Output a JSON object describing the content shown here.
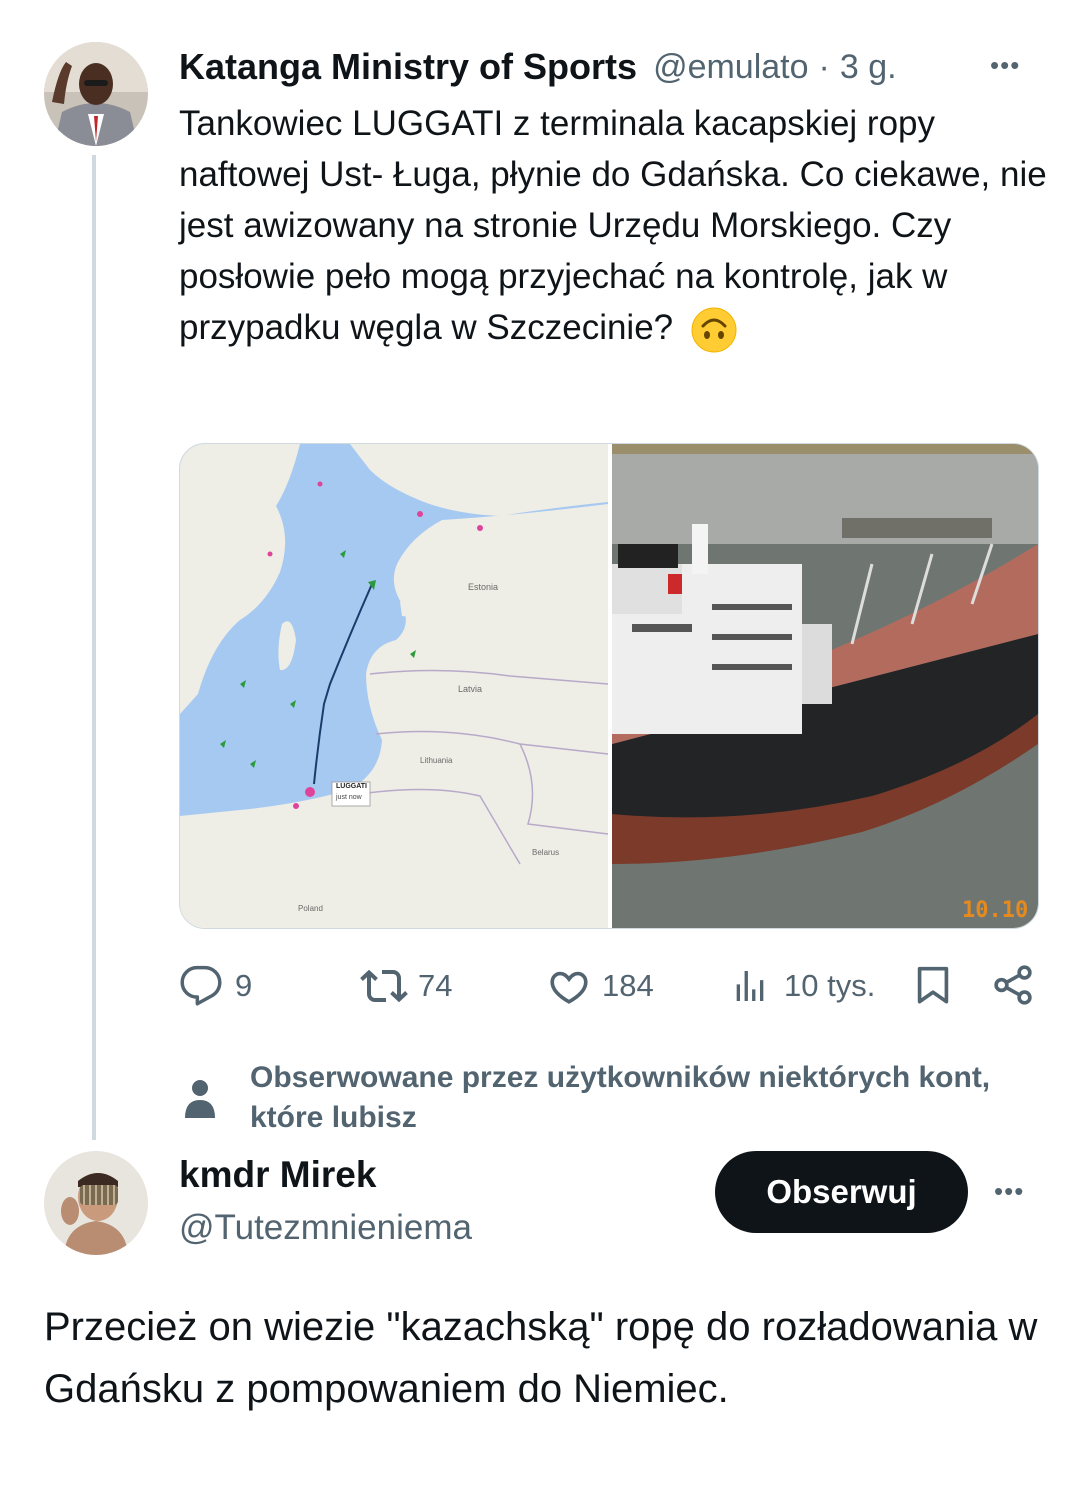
{
  "tweet": {
    "author_name": "Katanga Ministry of Sports",
    "handle": "@emulato",
    "separator": "·",
    "time": "3 g.",
    "more_label": "•••",
    "text": "Tankowiec LUGGATI z terminala kacapskiej ropy naftowej Ust- Ługa, płynie do Gdańska. Co ciekawe, nie jest awizowany na stronie Urzędu Morskiego. Czy posłowie peło mogą przyjechać na kontrolę, jak w przypadku węgla w Szczecinie?",
    "emoji": "upside-down-face",
    "map": {
      "countries": [
        "Estonia",
        "Latvia",
        "Lithuania",
        "Belarus",
        "Poland"
      ],
      "ship_label": "LUGGATI",
      "ship_status": "just now"
    },
    "photo_date": "10.10",
    "actions": {
      "replies": "9",
      "reposts": "74",
      "likes": "184",
      "views": "10 tys."
    }
  },
  "context": {
    "text": "Obserwowane przez użytkowników niektórych kont, które lubisz"
  },
  "reply": {
    "author_name": "kmdr Mirek",
    "handle": "@Tutezmnieniema",
    "follow_label": "Obserwuj",
    "more_label": "•••",
    "text": "Przecież on wiezie \"kazachską\" ropę do rozładowania w Gdańsku z pompowaniem do Niemiec."
  },
  "colors": {
    "text": "#0f1419",
    "muted": "#536471",
    "border": "#cfd9de",
    "sea": "#a6c9f2",
    "land": "#eeede6"
  }
}
